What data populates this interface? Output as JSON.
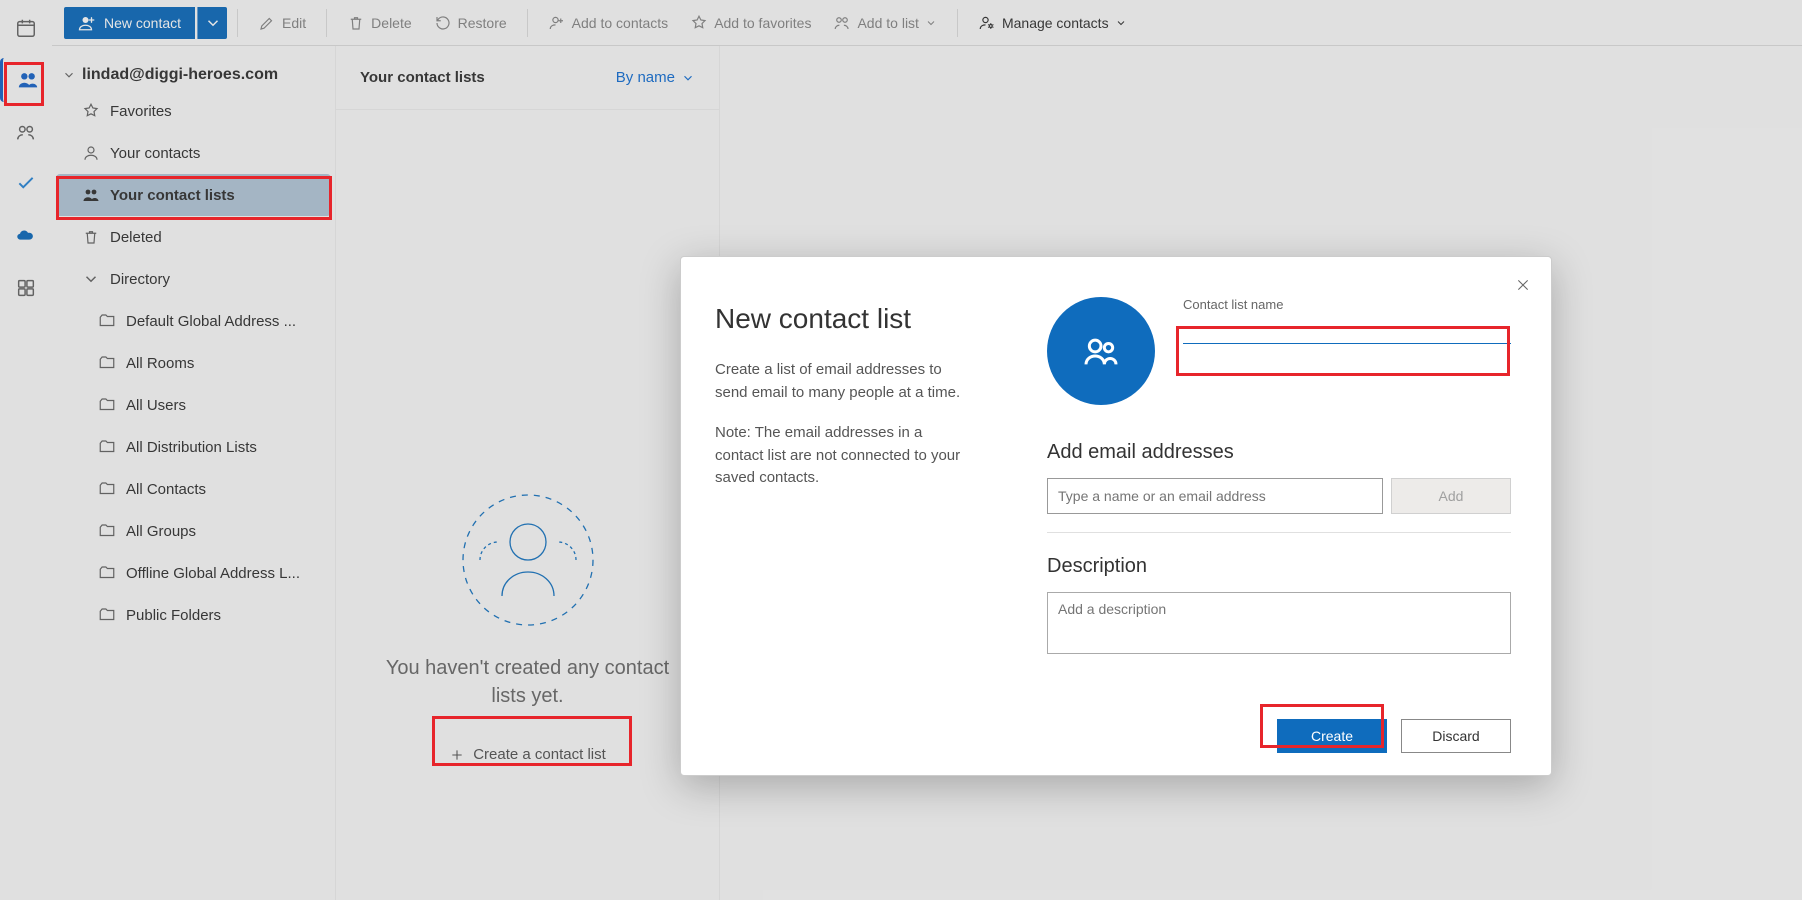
{
  "toolbar": {
    "new_contact": "New contact",
    "edit": "Edit",
    "delete": "Delete",
    "restore": "Restore",
    "add_to_contacts": "Add to contacts",
    "add_to_favorites": "Add to favorites",
    "add_to_list": "Add to list",
    "manage_contacts": "Manage contacts"
  },
  "account": {
    "email": "lindad@diggi-heroes.com"
  },
  "sidebar": {
    "favorites": "Favorites",
    "your_contacts": "Your contacts",
    "your_contact_lists": "Your contact lists",
    "deleted": "Deleted",
    "directory": "Directory",
    "directory_items": [
      "Default Global Address ...",
      "All Rooms",
      "All Users",
      "All Distribution Lists",
      "All Contacts",
      "All Groups",
      "Offline Global Address L...",
      "Public Folders"
    ]
  },
  "midcol": {
    "title": "Your contact lists",
    "sort_label": "By name",
    "empty_text": "You haven't created any contact lists yet.",
    "create_link": "Create a contact list"
  },
  "modal": {
    "title": "New contact list",
    "desc1": "Create a list of email addresses to send email to many people at a time.",
    "desc2": "Note: The email addresses in a contact list are not connected to your saved contacts.",
    "name_label": "Contact list name",
    "add_section": "Add email addresses",
    "email_placeholder": "Type a name or an email address",
    "add_btn": "Add",
    "desc_section": "Description",
    "desc_placeholder": "Add a description",
    "create_btn": "Create",
    "discard_btn": "Discard"
  }
}
